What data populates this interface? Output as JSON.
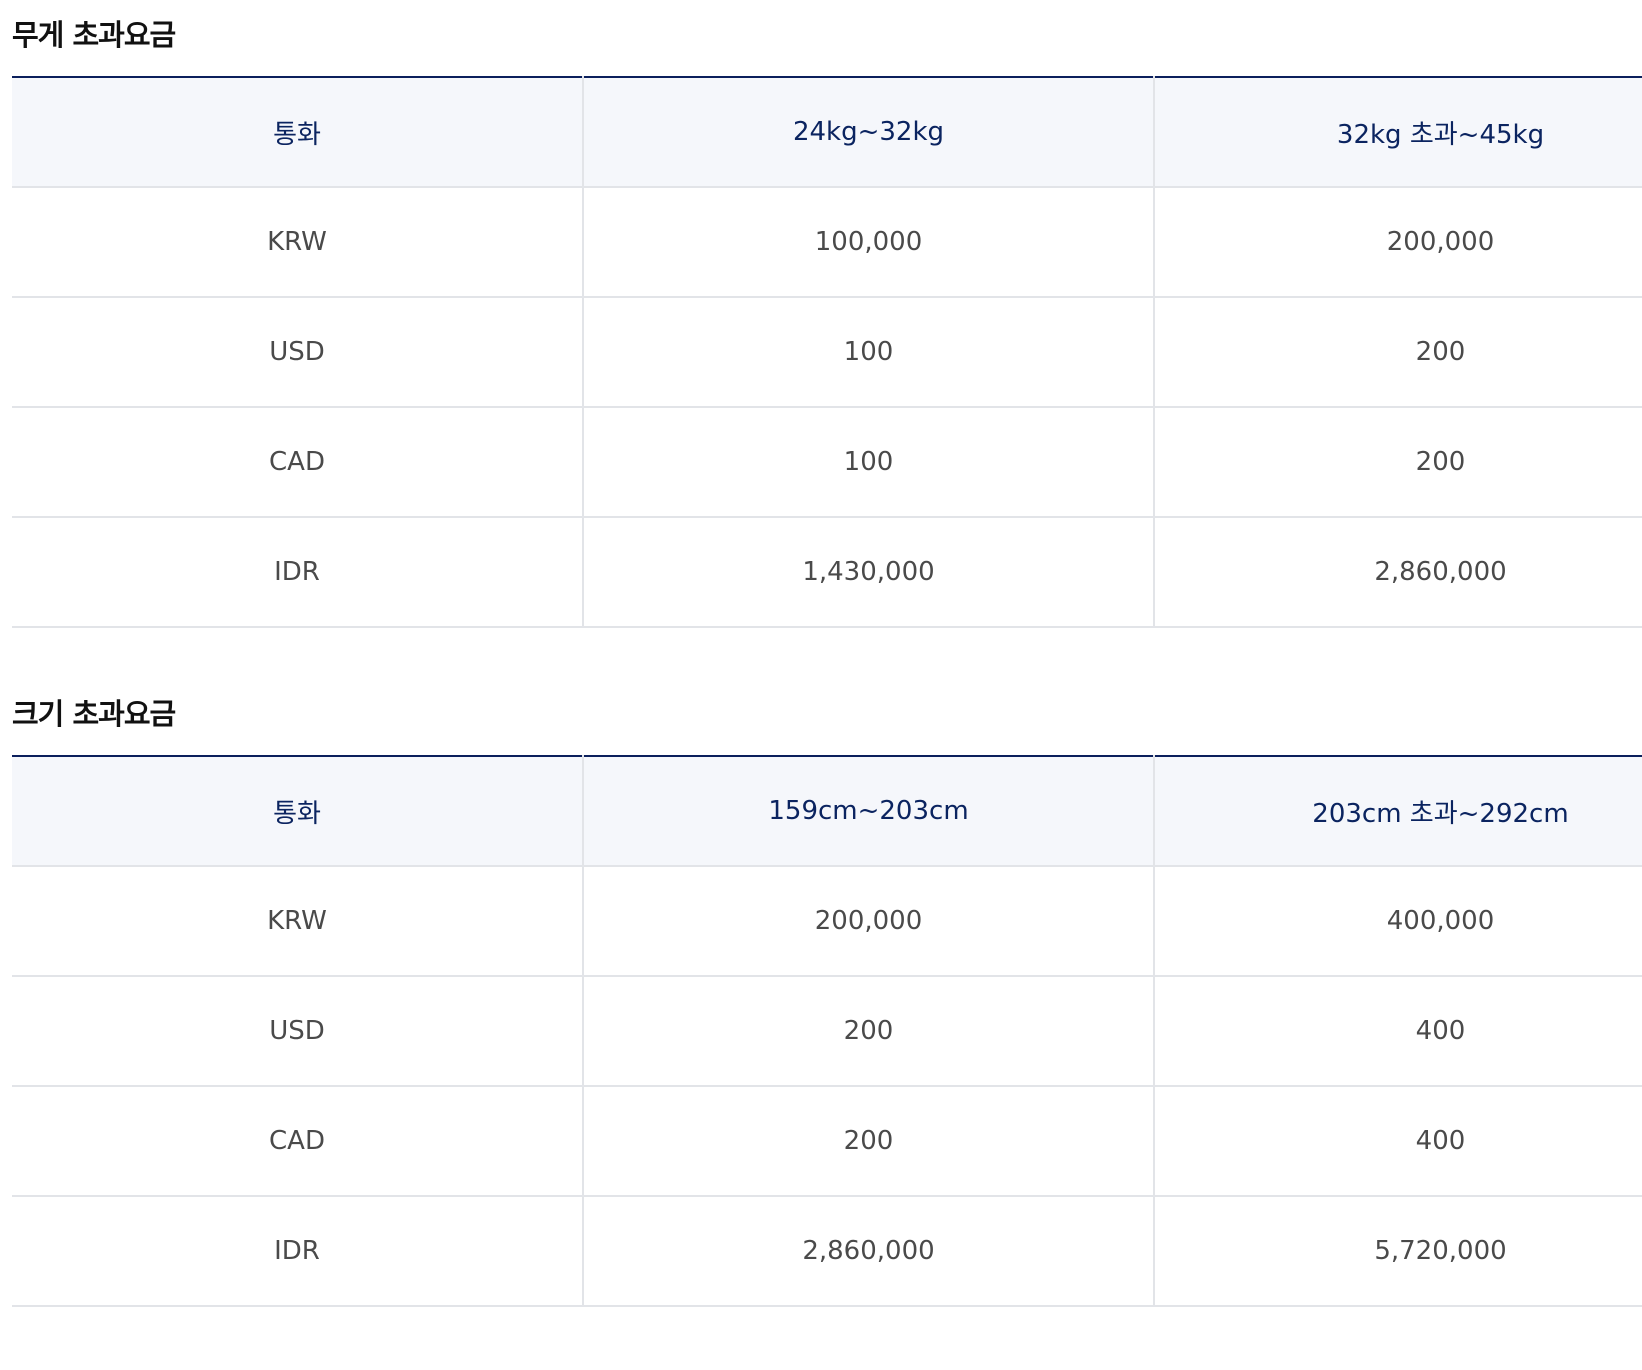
{
  "weight_section": {
    "title": "무게 초과요금",
    "headers": [
      "통화",
      "24kg~32kg",
      "32kg 초과~45kg"
    ],
    "rows": [
      [
        "KRW",
        "100,000",
        "200,000"
      ],
      [
        "USD",
        "100",
        "200"
      ],
      [
        "CAD",
        "100",
        "200"
      ],
      [
        "IDR",
        "1,430,000",
        "2,860,000"
      ]
    ]
  },
  "size_section": {
    "title": "크기 초과요금",
    "headers": [
      "통화",
      "159cm~203cm",
      "203cm 초과~292cm"
    ],
    "rows": [
      [
        "KRW",
        "200,000",
        "400,000"
      ],
      [
        "USD",
        "200",
        "400"
      ],
      [
        "CAD",
        "200",
        "400"
      ],
      [
        "IDR",
        "2,860,000",
        "5,720,000"
      ]
    ]
  },
  "colors": {
    "header_text": "#0b2460",
    "header_bg": "#f5f7fb",
    "top_border": "#0b1f5c",
    "grid_line": "#e2e4e8"
  }
}
